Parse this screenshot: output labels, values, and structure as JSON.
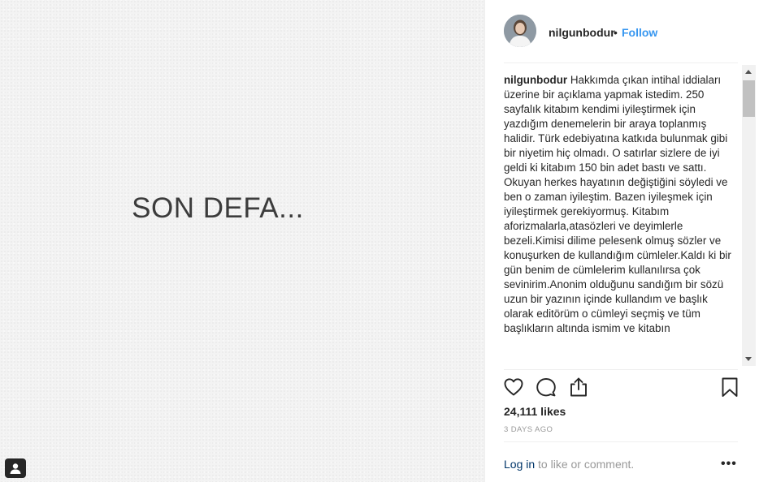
{
  "media": {
    "text": "SON DEFA..."
  },
  "post": {
    "username": "nilgunbodur",
    "separator": "•",
    "follow_label": "Follow",
    "caption_user": "nilgunbodur",
    "caption_text": "Hakkımda çıkan intihal iddiaları üzerine bir açıklama yapmak istedim. 250 sayfalık kitabım kendimi iyileştirmek için yazdığım denemelerin bir araya toplanmış halidir. Türk edebiyatına katkıda bulunmak gibi bir niyetim hiç olmadı. O satırlar sizlere de iyi geldi ki kitabım 150 bin adet bastı ve sattı. Okuyan herkes hayatının değiştiğini söyledi ve ben o zaman iyileştim. Bazen iyileşmek için iyileştirmek gerekiyormuş. Kitabım aforizmalarla,atasözleri ve deyimlerle bezeli.Kimisi dilime pelesenk olmuş sözler ve konuşurken de kullandığım cümleler.Kaldı ki bir gün benim de cümlelerim kullanılırsa çok sevinirim.Anonim olduğunu sandığım bir sözü uzun bir yazının içinde kullandım ve başlık olarak editörüm o cümleyi seçmiş ve tüm başlıkların altında ismim ve kitabın",
    "likes": "24,111 likes",
    "timestamp": "3 DAYS AGO"
  },
  "footer": {
    "login_label": "Log in",
    "rest_label": " to like or comment.",
    "more_label": "•••"
  },
  "icons": {
    "like": "heart-icon",
    "comment": "comment-icon",
    "share": "share-icon",
    "save": "bookmark-icon",
    "more": "more-options-icon",
    "tag": "user-tag-icon"
  },
  "colors": {
    "link_blue": "#3897f0",
    "login_link": "#003569",
    "muted": "#999999",
    "text": "#262626"
  }
}
